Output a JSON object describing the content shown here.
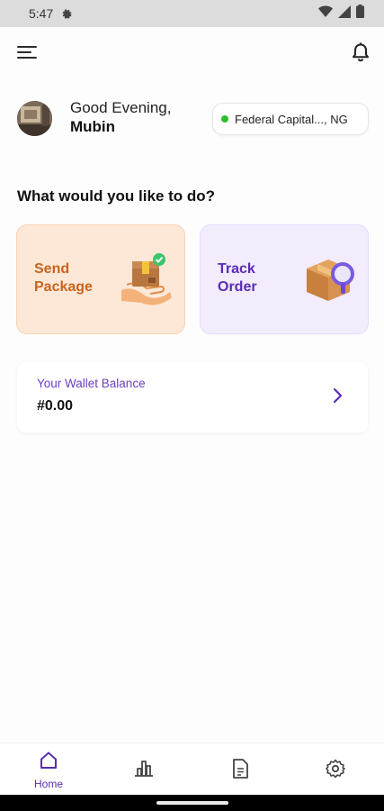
{
  "status_bar": {
    "time": "5:47",
    "icons": [
      "gear-icon",
      "wifi-icon",
      "signal-icon",
      "battery-icon"
    ]
  },
  "header": {
    "menu_icon": "menu-icon",
    "bell_icon": "bell-icon"
  },
  "user": {
    "greeting": "Good Evening,",
    "name": "Mubin"
  },
  "location": {
    "text": "Federal Capital..., NG",
    "status_color": "#2bc02b"
  },
  "actions": {
    "title": "What would you like to do?",
    "send": {
      "line1": "Send",
      "line2": "Package",
      "icon": "package-hand-icon"
    },
    "track": {
      "line1": "Track",
      "line2": "Order",
      "icon": "box-search-icon"
    }
  },
  "wallet": {
    "label": "Your Wallet Balance",
    "balance": "#0.00"
  },
  "bottom_nav": {
    "items": [
      {
        "label": "Home",
        "icon": "home-icon",
        "active": true
      },
      {
        "label": "",
        "icon": "chart-icon",
        "active": false
      },
      {
        "label": "",
        "icon": "document-icon",
        "active": false
      },
      {
        "label": "",
        "icon": "settings-icon",
        "active": false
      }
    ]
  },
  "colors": {
    "accent": "#5a2bb5",
    "send_card": "#fde8d7",
    "track_card": "#f2ecfd",
    "send_text": "#c8641f"
  }
}
